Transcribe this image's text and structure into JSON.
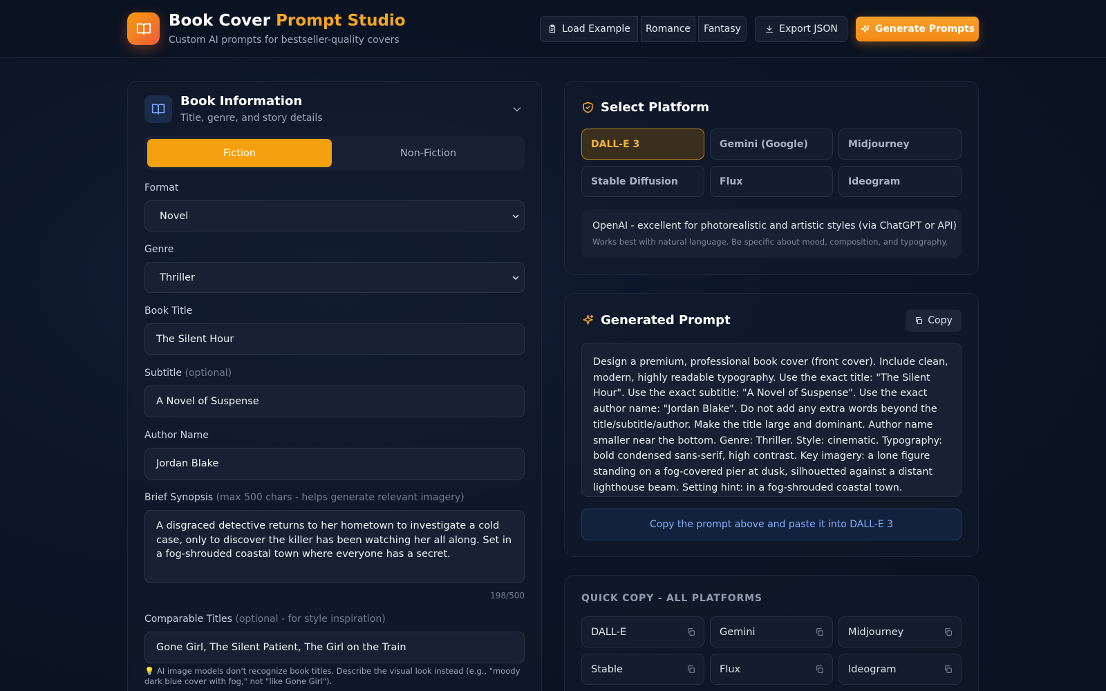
{
  "header": {
    "title_main": "Book Cover",
    "title_accent": "Prompt Studio",
    "subtitle": "Custom AI prompts for bestseller-quality covers",
    "load_example": "Load Example",
    "romance": "Romance",
    "fantasy": "Fantasy",
    "export_json": "Export JSON",
    "generate": "Generate Prompts"
  },
  "book_info": {
    "title": "Book Information",
    "subtitle": "Title, genre, and story details",
    "type_tabs": [
      "Fiction",
      "Non-Fiction"
    ],
    "active_tab": "Fiction",
    "format_label": "Format",
    "format_value": "Novel",
    "genre_label": "Genre",
    "genre_value": "Thriller",
    "book_title_label": "Book Title",
    "book_title_value": "The Silent Hour",
    "subtitle_label": "Subtitle",
    "subtitle_hint": "(optional)",
    "subtitle_value": "A Novel of Suspense",
    "author_label": "Author Name",
    "author_value": "Jordan Blake",
    "synopsis_label": "Brief Synopsis",
    "synopsis_hint": "(max 500 chars - helps generate relevant imagery)",
    "synopsis_value": "A disgraced detective returns to her hometown to investigate a cold case, only to discover the killer has been watching her all along. Set in a fog-shrouded coastal town where everyone has a secret.",
    "synopsis_count": "198/500",
    "comparable_label": "Comparable Titles",
    "comparable_hint": "(optional - for style inspiration)",
    "comparable_value": "Gone Girl, The Silent Patient, The Girl on the Train",
    "tip": "💡 AI image models don't recognize book titles. Describe the visual look instead (e.g., \"moody dark blue cover with fog,\" not \"like Gone Girl\")."
  },
  "platform": {
    "title": "Select Platform",
    "options": [
      "DALL-E 3",
      "Gemini (Google)",
      "Midjourney",
      "Stable Diffusion",
      "Flux",
      "Ideogram"
    ],
    "active": "DALL-E 3",
    "desc": "OpenAI - excellent for photorealistic and artistic styles (via ChatGPT or API)",
    "hint": "Works best with natural language. Be specific about mood, composition, and typography."
  },
  "generated": {
    "title": "Generated Prompt",
    "copy": "Copy",
    "prompt": "Design a premium, professional book cover (front cover). Include clean, modern, highly readable typography. Use the exact title: \"The Silent Hour\". Use the exact subtitle: \"A Novel of Suspense\". Use the exact author name: \"Jordan Blake\". Do not add any extra words beyond the title/subtitle/author. Make the title large and dominant. Author name smaller near the bottom. Genre: Thriller. Style: cinematic. Typography: bold condensed sans-serif, high contrast. Key imagery: a lone figure standing on a fog-covered pier at dusk, silhouetted against a distant lighthouse beam. Setting hint: in a fog-shrouded coastal town. Atmosphere: cold. Mood: tense, ominous. Color palette: deep",
    "paste_hint": "Copy the prompt above and paste it into DALL-E 3"
  },
  "quick_copy": {
    "title": "QUICK COPY - ALL PLATFORMS",
    "items": [
      "DALL-E",
      "Gemini",
      "Midjourney",
      "Stable",
      "Flux",
      "Ideogram"
    ]
  },
  "colors": {
    "accent": "#f5a623",
    "background": "#0b1424",
    "active_platform": "#3a2f1c"
  }
}
